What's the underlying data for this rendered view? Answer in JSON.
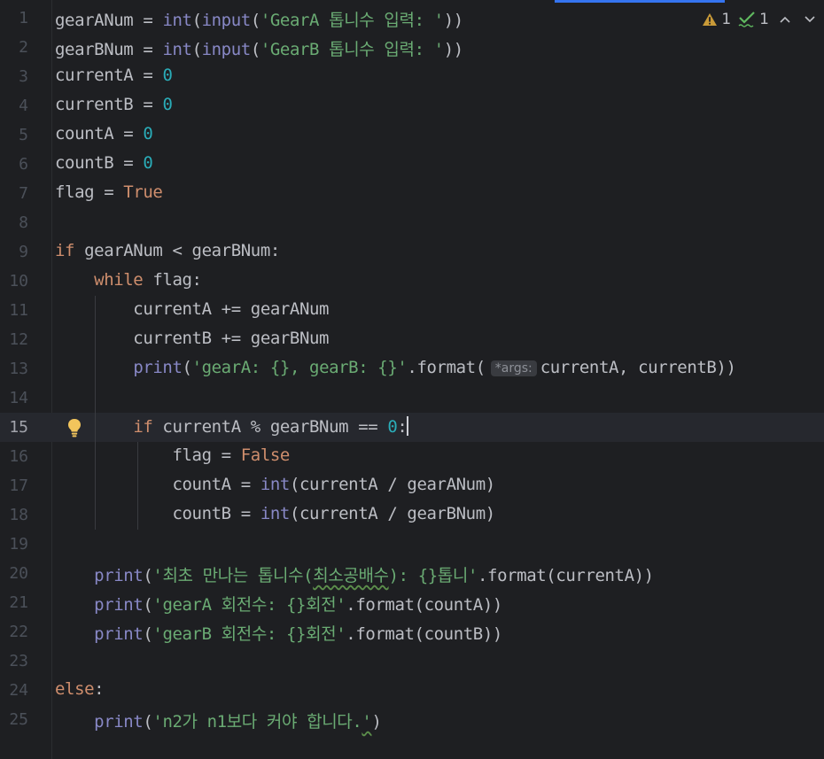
{
  "inspections": {
    "warning_count": "1",
    "typo_count": "1"
  },
  "colors": {
    "background": "#1e1f22",
    "keyword": "#cf8e6d",
    "builtin": "#8888c6",
    "string": "#6aab73",
    "number": "#2aacb8",
    "identifier": "#bcbec4",
    "warning": "#c99a38",
    "ok": "#5fb85f",
    "accent": "#3574f0"
  },
  "icons": {
    "warning": "warning-triangle-icon",
    "typo": "typo-check-icon",
    "prev": "chevron-up-icon",
    "next": "chevron-down-icon",
    "intention": "lightbulb-icon"
  },
  "code": {
    "line_numbers": [
      "1",
      "2",
      "3",
      "4",
      "5",
      "6",
      "7",
      "8",
      "9",
      "10",
      "11",
      "12",
      "13",
      "14",
      "15",
      "16",
      "17",
      "18",
      "19",
      "20",
      "21",
      "22",
      "23",
      "24",
      "25"
    ],
    "current_line": "15",
    "param_hint": "*args:",
    "tokens": {
      "l1": [
        "gearANum = ",
        "int",
        "(",
        "input",
        "(",
        "'GearA 톱니수 입력: '",
        "))"
      ],
      "l2": [
        "gearBNum = ",
        "int",
        "(",
        "input",
        "(",
        "'GearB 톱니수 입력: '",
        "))"
      ],
      "l3": [
        "currentA = ",
        "0"
      ],
      "l4": [
        "currentB = ",
        "0"
      ],
      "l5": [
        "countA = ",
        "0"
      ],
      "l6": [
        "countB = ",
        "0"
      ],
      "l7": [
        "flag = ",
        "True"
      ],
      "l9": [
        "if",
        " gearANum < gearBNum:"
      ],
      "l10": [
        "    ",
        "while",
        " flag:"
      ],
      "l11": [
        "        currentA += gearANum"
      ],
      "l12": [
        "        currentB += gearBNum"
      ],
      "l13": [
        "        ",
        "print",
        "(",
        "'gearA: {}, gearB: {}'",
        ".format(",
        "currentA, currentB))"
      ],
      "l15": [
        "        ",
        "if",
        " currentA % gearBNum == ",
        "0",
        ":"
      ],
      "l16": [
        "            flag = ",
        "False"
      ],
      "l17": [
        "            countA = ",
        "int",
        "(currentA / gearANum)"
      ],
      "l18": [
        "            countB = ",
        "int",
        "(currentA / gearBNum)"
      ],
      "l20": [
        "    ",
        "print",
        "(",
        "'최초 만나는 톱니수(",
        "최소공배수",
        "): {}톱니'",
        ".format(currentA))"
      ],
      "l21": [
        "    ",
        "print",
        "(",
        "'gearA 회전수: {}회전'",
        ".format(countA))"
      ],
      "l22": [
        "    ",
        "print",
        "(",
        "'gearB 회전수: {}회전'",
        ".format(countB))"
      ],
      "l24": [
        "else",
        ":"
      ],
      "l25": [
        "    ",
        "print",
        "(",
        "'n2가 n1보다 커야 합니다.",
        "'",
        ")"
      ]
    }
  }
}
